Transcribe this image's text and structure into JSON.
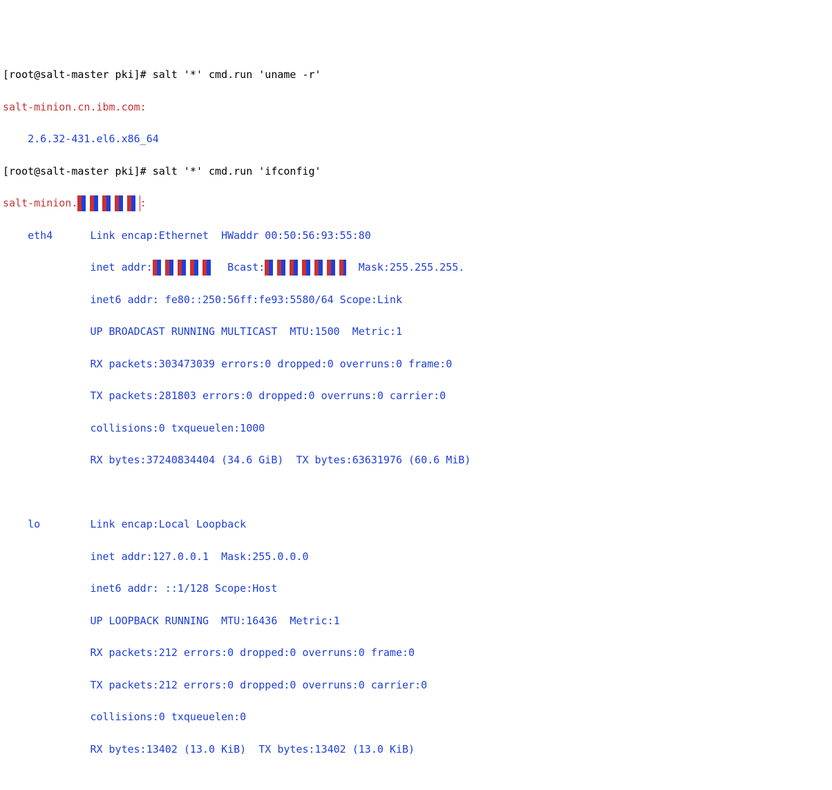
{
  "terminal": {
    "prompt1_prefix": "[root@salt-master pki]# ",
    "command1": "salt '*' cmd.run 'uname -r'",
    "minion1_name": "salt-minion.cn.ibm.com:",
    "uname_output": "2.6.32-431.el6.x86_64",
    "prompt2_prefix": "[root@salt-master pki]# ",
    "command2": "salt '*' cmd.run 'ifconfig'",
    "minion2_label": "salt-minion.",
    "minion2_redacted": "** *** ***",
    "minion2_colon": ":",
    "eth_name": "eth4",
    "eth_link": "Link encap:Ethernet  HWaddr 00:50:56:93:55:80",
    "eth_inet_label": "inet addr:",
    "eth_inet_redacted1": "* ** *** *",
    "eth_bcast_label": "  Bcast:",
    "eth_inet_redacted2": "*.***.***.***",
    "eth_mask": "  Mask:255.255.255.",
    "eth_inet6": "inet6 addr: fe80::250:56ff:fe93:5580/64 Scope:Link",
    "eth_flags": "UP BROADCAST RUNNING MULTICAST  MTU:1500  Metric:1",
    "eth_rx_pkts": "RX packets:303473039 errors:0 dropped:0 overruns:0 frame:0",
    "eth_tx_pkts": "TX packets:281803 errors:0 dropped:0 overruns:0 carrier:0",
    "eth_coll": "collisions:0 txqueuelen:1000",
    "eth_bytes": "RX bytes:37240834404 (34.6 GiB)  TX bytes:63631976 (60.6 MiB)",
    "lo_name": "lo",
    "lo_link": "Link encap:Local Loopback",
    "lo_inet": "inet addr:127.0.0.1  Mask:255.0.0.0",
    "lo_inet6": "inet6 addr: ::1/128 Scope:Host",
    "lo_flags": "UP LOOPBACK RUNNING  MTU:16436  Metric:1",
    "lo_rx_pkts": "RX packets:212 errors:0 dropped:0 overruns:0 frame:0",
    "lo_tx_pkts": "TX packets:212 errors:0 dropped:0 overruns:0 carrier:0",
    "lo_coll": "collisions:0 txqueuelen:0",
    "lo_bytes": "RX bytes:13402 (13.0 KiB)  TX bytes:13402 (13.0 KiB)"
  }
}
